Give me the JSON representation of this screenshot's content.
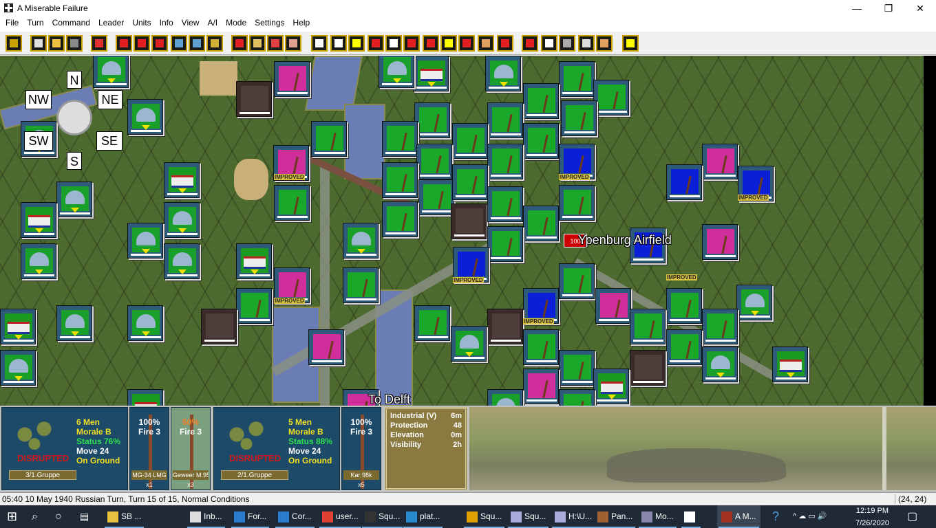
{
  "window": {
    "title": "A Miserable Failure",
    "minimize": "—",
    "maximize": "❐",
    "close": "✕"
  },
  "menu": [
    "File",
    "Turn",
    "Command",
    "Leader",
    "Units",
    "Info",
    "View",
    "A/I",
    "Mode",
    "Settings",
    "Help"
  ],
  "map": {
    "compass": {
      "n": "N",
      "ne": "NE",
      "nw": "NW",
      "se": "SE",
      "sw": "SW",
      "s": "S"
    },
    "labels": {
      "airfield": "Ypenburg Airfield",
      "delft": "To Delft",
      "vp": "100"
    },
    "improved": "IMPROVED"
  },
  "units": [
    {
      "icon": "soldiers",
      "men": "6 Men",
      "morale": "Morale B",
      "status": "Status 76%",
      "move": "Move 24",
      "position": "On Ground",
      "state": "DISRUPTED",
      "group": "3/1.Gruppe",
      "weapons": [
        {
          "pct": "100%",
          "fire": "Fire 3",
          "name": "MG-34 LMG",
          "count": "x1"
        },
        {
          "pct": "50%",
          "fire": "Fire 3",
          "name": "Geweer M.95",
          "count": "x3",
          "selected": true
        }
      ]
    },
    {
      "icon": "soldiers",
      "men": "5 Men",
      "morale": "Morale B",
      "status": "Status 88%",
      "move": "Move 24",
      "position": "On Ground",
      "state": "DISRUPTED",
      "group": "2/1.Gruppe",
      "weapons": [
        {
          "pct": "100%",
          "fire": "Fire 3",
          "name": "Kar 98k",
          "count": "x5"
        }
      ]
    }
  ],
  "terrain": {
    "rows": [
      {
        "k": "Industrial (V)",
        "v": "6m"
      },
      {
        "k": "Protection",
        "v": "48"
      },
      {
        "k": "Elevation",
        "v": "0m"
      },
      {
        "k": "Visibility",
        "v": "2h"
      }
    ]
  },
  "status": {
    "text": "05:40 10 May 1940 Russian Turn, Turn 15 of 15, Normal Conditions",
    "coords": "(24, 24)"
  },
  "taskbar": {
    "items": [
      "SB ...",
      "Inb...",
      "For...",
      "Cor...",
      "user...",
      "Squ...",
      "plat...",
      "Squ...",
      "Squ...",
      "H:\\U...",
      "Pan...",
      "Mo...",
      "",
      "A M..."
    ],
    "time": "12:19 PM",
    "date": "7/26/2020"
  },
  "colors": {
    "map": "#4d6a2e",
    "counter": "#2e5a7a",
    "panel": "#1e4a6a"
  }
}
